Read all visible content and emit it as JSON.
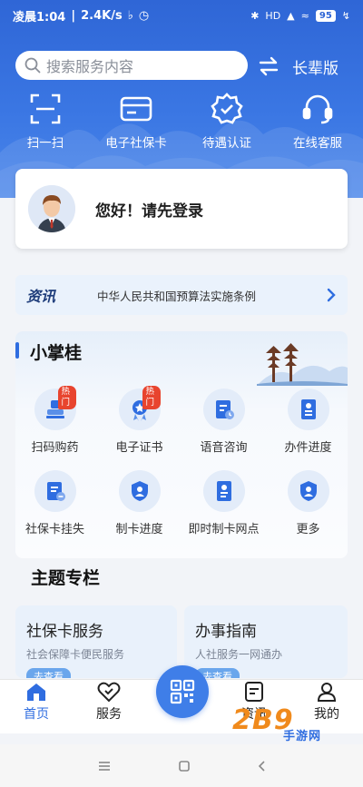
{
  "status_bar": {
    "time": "凌晨1:04",
    "speed": "2.4K/s",
    "network": "HD",
    "battery": "95"
  },
  "search": {
    "placeholder": "搜索服务内容"
  },
  "elder_mode": {
    "label": "长辈版"
  },
  "quick_actions": [
    {
      "label": "扫一扫",
      "icon": "scan-icon"
    },
    {
      "label": "电子社保卡",
      "icon": "card-icon"
    },
    {
      "label": "待遇认证",
      "icon": "verify-badge-icon"
    },
    {
      "label": "在线客服",
      "icon": "headset-icon"
    }
  ],
  "login": {
    "greeting": "您好！请先登录"
  },
  "news": {
    "tag": "资讯",
    "headline": "中华人民共和国预算法实施条例"
  },
  "xiaozhanggui": {
    "title": "小掌桂",
    "items": [
      {
        "label": "扫码购药",
        "badge": "热门",
        "icon": "stamp-icon"
      },
      {
        "label": "电子证书",
        "badge": "热门",
        "icon": "certificate-icon"
      },
      {
        "label": "语音咨询",
        "badge": "",
        "icon": "voice-consult-icon"
      },
      {
        "label": "办件进度",
        "badge": "",
        "icon": "progress-doc-icon"
      },
      {
        "label": "社保卡挂失",
        "badge": "",
        "icon": "card-loss-icon"
      },
      {
        "label": "制卡进度",
        "badge": "",
        "icon": "card-progress-icon"
      },
      {
        "label": "即时制卡网点",
        "badge": "",
        "icon": "instant-card-icon"
      },
      {
        "label": "更多",
        "badge": "",
        "icon": "more-icon"
      }
    ]
  },
  "themes": {
    "title": "主题专栏",
    "cards": [
      {
        "title": "社保卡服务",
        "subtitle": "社会保障卡便民服务",
        "button": "去查看"
      },
      {
        "title": "办事指南",
        "subtitle": "人社服务一网通办",
        "button": "去查看"
      }
    ]
  },
  "tabbar": [
    {
      "label": "首页",
      "icon": "home-icon",
      "active": true
    },
    {
      "label": "服务",
      "icon": "heart-service-icon",
      "active": false
    },
    {
      "label": "资讯",
      "icon": "news-doc-icon",
      "active": false
    },
    {
      "label": "我的",
      "icon": "user-icon",
      "active": false
    }
  ],
  "watermark": {
    "text": "2B9",
    "suffix": "手游网"
  },
  "colors": {
    "primary": "#2f6de0",
    "hot_badge": "#e8442e"
  }
}
